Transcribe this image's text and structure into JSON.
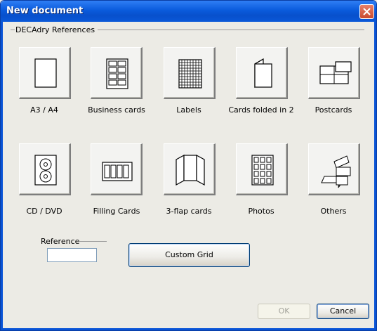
{
  "window": {
    "title": "New document",
    "close_icon": "close-icon"
  },
  "group": {
    "label": "DECAdry References"
  },
  "tiles": [
    {
      "label": "A3 / A4",
      "icon": "page-icon"
    },
    {
      "label": "Business cards",
      "icon": "business-cards-icon"
    },
    {
      "label": "Labels",
      "icon": "labels-grid-icon"
    },
    {
      "label": "Cards folded in 2",
      "icon": "folded-card-icon"
    },
    {
      "label": "Postcards",
      "icon": "postcards-icon"
    },
    {
      "label": "CD / DVD",
      "icon": "cd-dvd-icon"
    },
    {
      "label": "Filling Cards",
      "icon": "filling-cards-icon"
    },
    {
      "label": "3-flap cards",
      "icon": "three-flap-card-icon"
    },
    {
      "label": "Photos",
      "icon": "photos-icon"
    },
    {
      "label": "Others",
      "icon": "others-icon"
    }
  ],
  "reference": {
    "label": "Reference",
    "value": ""
  },
  "custom_grid": {
    "label": "Custom Grid"
  },
  "buttons": {
    "ok": "OK",
    "cancel": "Cancel"
  }
}
